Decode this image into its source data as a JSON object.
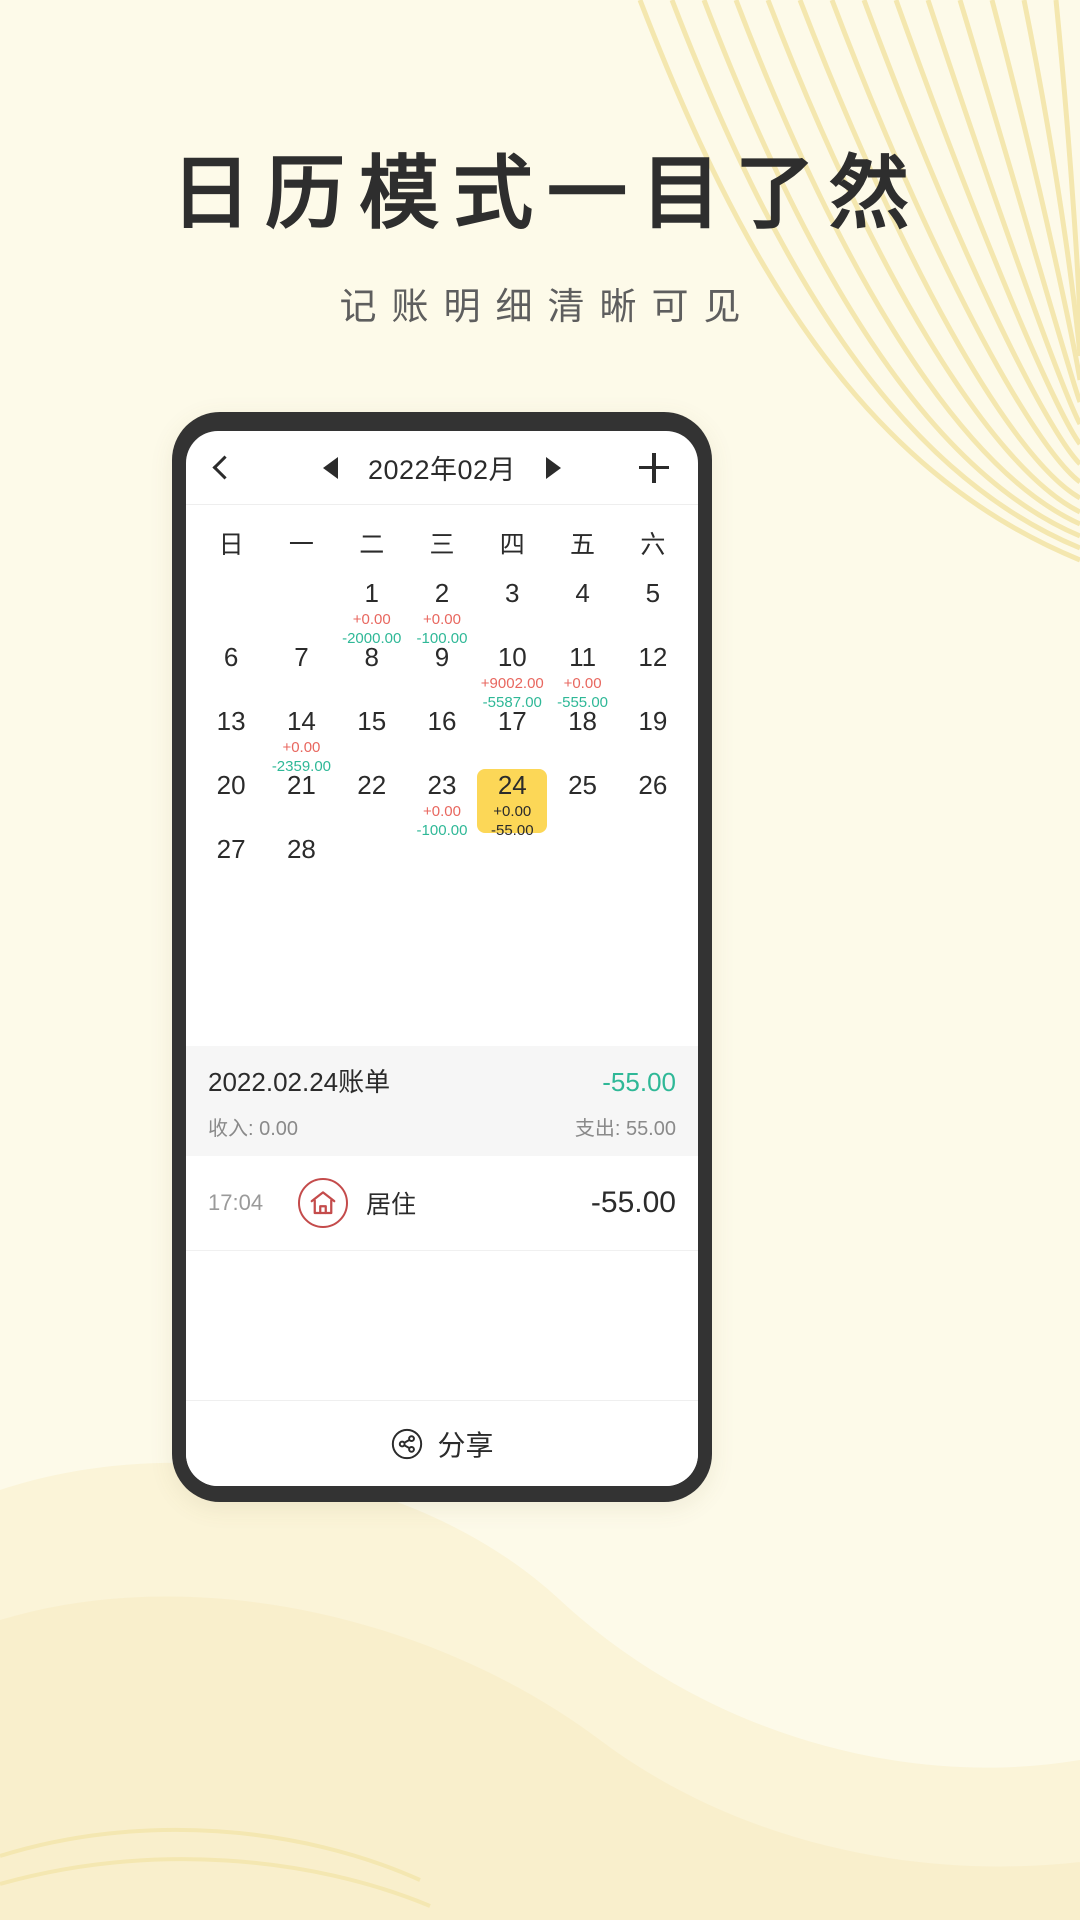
{
  "promo": {
    "title": "日历模式一目了然",
    "subtitle": "记账明细清晰可见",
    "title_color": "#2E2E2E",
    "subtitle_color": "#5E5E5E",
    "background_color": "#FDFAE9",
    "accent_color": "#F5E6A8"
  },
  "app": {
    "header": {
      "back_icon": "chevron-left-icon",
      "prev_icon": "triangle-left-icon",
      "month_label": "2022年02月",
      "next_icon": "triangle-right-icon",
      "add_icon": "plus-icon"
    },
    "weekdays": [
      "日",
      "一",
      "二",
      "三",
      "四",
      "五",
      "六"
    ],
    "colors": {
      "income": "#E8675F",
      "expense": "#2FB897",
      "selected_bg": "#FCD757",
      "summary_bg": "#F6F6F6"
    },
    "calendar": {
      "leading_blanks": 2,
      "days": [
        {
          "day": "1",
          "income": "+0.00",
          "expense": "-2000.00",
          "selected": false
        },
        {
          "day": "2",
          "income": "+0.00",
          "expense": "-100.00",
          "selected": false
        },
        {
          "day": "3",
          "income": "",
          "expense": "",
          "selected": false
        },
        {
          "day": "4",
          "income": "",
          "expense": "",
          "selected": false
        },
        {
          "day": "5",
          "income": "",
          "expense": "",
          "selected": false
        },
        {
          "day": "6",
          "income": "",
          "expense": "",
          "selected": false
        },
        {
          "day": "7",
          "income": "",
          "expense": "",
          "selected": false
        },
        {
          "day": "8",
          "income": "",
          "expense": "",
          "selected": false
        },
        {
          "day": "9",
          "income": "",
          "expense": "",
          "selected": false
        },
        {
          "day": "10",
          "income": "+9002.00",
          "expense": "-5587.00",
          "selected": false
        },
        {
          "day": "11",
          "income": "+0.00",
          "expense": "-555.00",
          "selected": false
        },
        {
          "day": "12",
          "income": "",
          "expense": "",
          "selected": false
        },
        {
          "day": "13",
          "income": "",
          "expense": "",
          "selected": false
        },
        {
          "day": "14",
          "income": "+0.00",
          "expense": "-2359.00",
          "selected": false
        },
        {
          "day": "15",
          "income": "",
          "expense": "",
          "selected": false
        },
        {
          "day": "16",
          "income": "",
          "expense": "",
          "selected": false
        },
        {
          "day": "17",
          "income": "",
          "expense": "",
          "selected": false
        },
        {
          "day": "18",
          "income": "",
          "expense": "",
          "selected": false
        },
        {
          "day": "19",
          "income": "",
          "expense": "",
          "selected": false
        },
        {
          "day": "20",
          "income": "",
          "expense": "",
          "selected": false
        },
        {
          "day": "21",
          "income": "",
          "expense": "",
          "selected": false
        },
        {
          "day": "22",
          "income": "",
          "expense": "",
          "selected": false
        },
        {
          "day": "23",
          "income": "+0.00",
          "expense": "-100.00",
          "selected": false
        },
        {
          "day": "24",
          "income": "+0.00",
          "expense": "-55.00",
          "selected": true
        },
        {
          "day": "25",
          "income": "",
          "expense": "",
          "selected": false
        },
        {
          "day": "26",
          "income": "",
          "expense": "",
          "selected": false
        },
        {
          "day": "27",
          "income": "",
          "expense": "",
          "selected": false
        },
        {
          "day": "28",
          "income": "",
          "expense": "",
          "selected": false
        }
      ]
    },
    "summary": {
      "date_label": "2022.02.24账单",
      "net": "-55.00",
      "income_label": "收入: 0.00",
      "expense_label": "支出: 55.00"
    },
    "transactions": [
      {
        "time": "17:04",
        "icon": "home-icon",
        "category": "居住",
        "amount": "-55.00"
      }
    ],
    "share": {
      "icon": "share-icon",
      "label": "分享"
    }
  }
}
